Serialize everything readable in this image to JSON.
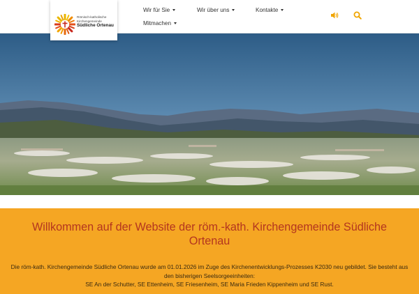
{
  "logo": {
    "line1": "Römisch-katholische",
    "line2": "Kirchengemeinde",
    "line3": "Südliche Ortenau"
  },
  "nav": {
    "items": [
      {
        "label": "Wir für Sie"
      },
      {
        "label": "Wir über uns"
      },
      {
        "label": "Kontakte"
      },
      {
        "label": "Mitmachen"
      }
    ],
    "speaker_icon": "speaker-icon",
    "search_icon": "search-icon"
  },
  "hero": {
    "alt": "Panorama der Ortenau mit Obstblüte und Schwarzwaldbergen"
  },
  "banner": {
    "title": "Willkommen auf der Website  der röm.-kath. Kirchengemeinde Südliche Ortenau",
    "paragraph1": "Die röm-kath. Kirchengemeinde Südliche Ortenau wurde am 01.01.2026 im Zuge des Kirchenentwicklungs-Prozesses K2030 neu gebildet. Sie besteht aus den bisherigen Seelsorgeeinheiten:",
    "paragraph2": "SE An der Schutter, SE Ettenheim, SE Friesenheim, SE Maria Frieden Kippenheim und SE Rust."
  },
  "colors": {
    "accent": "#f5a623",
    "title": "#b4361f",
    "icon": "#f0a500"
  }
}
